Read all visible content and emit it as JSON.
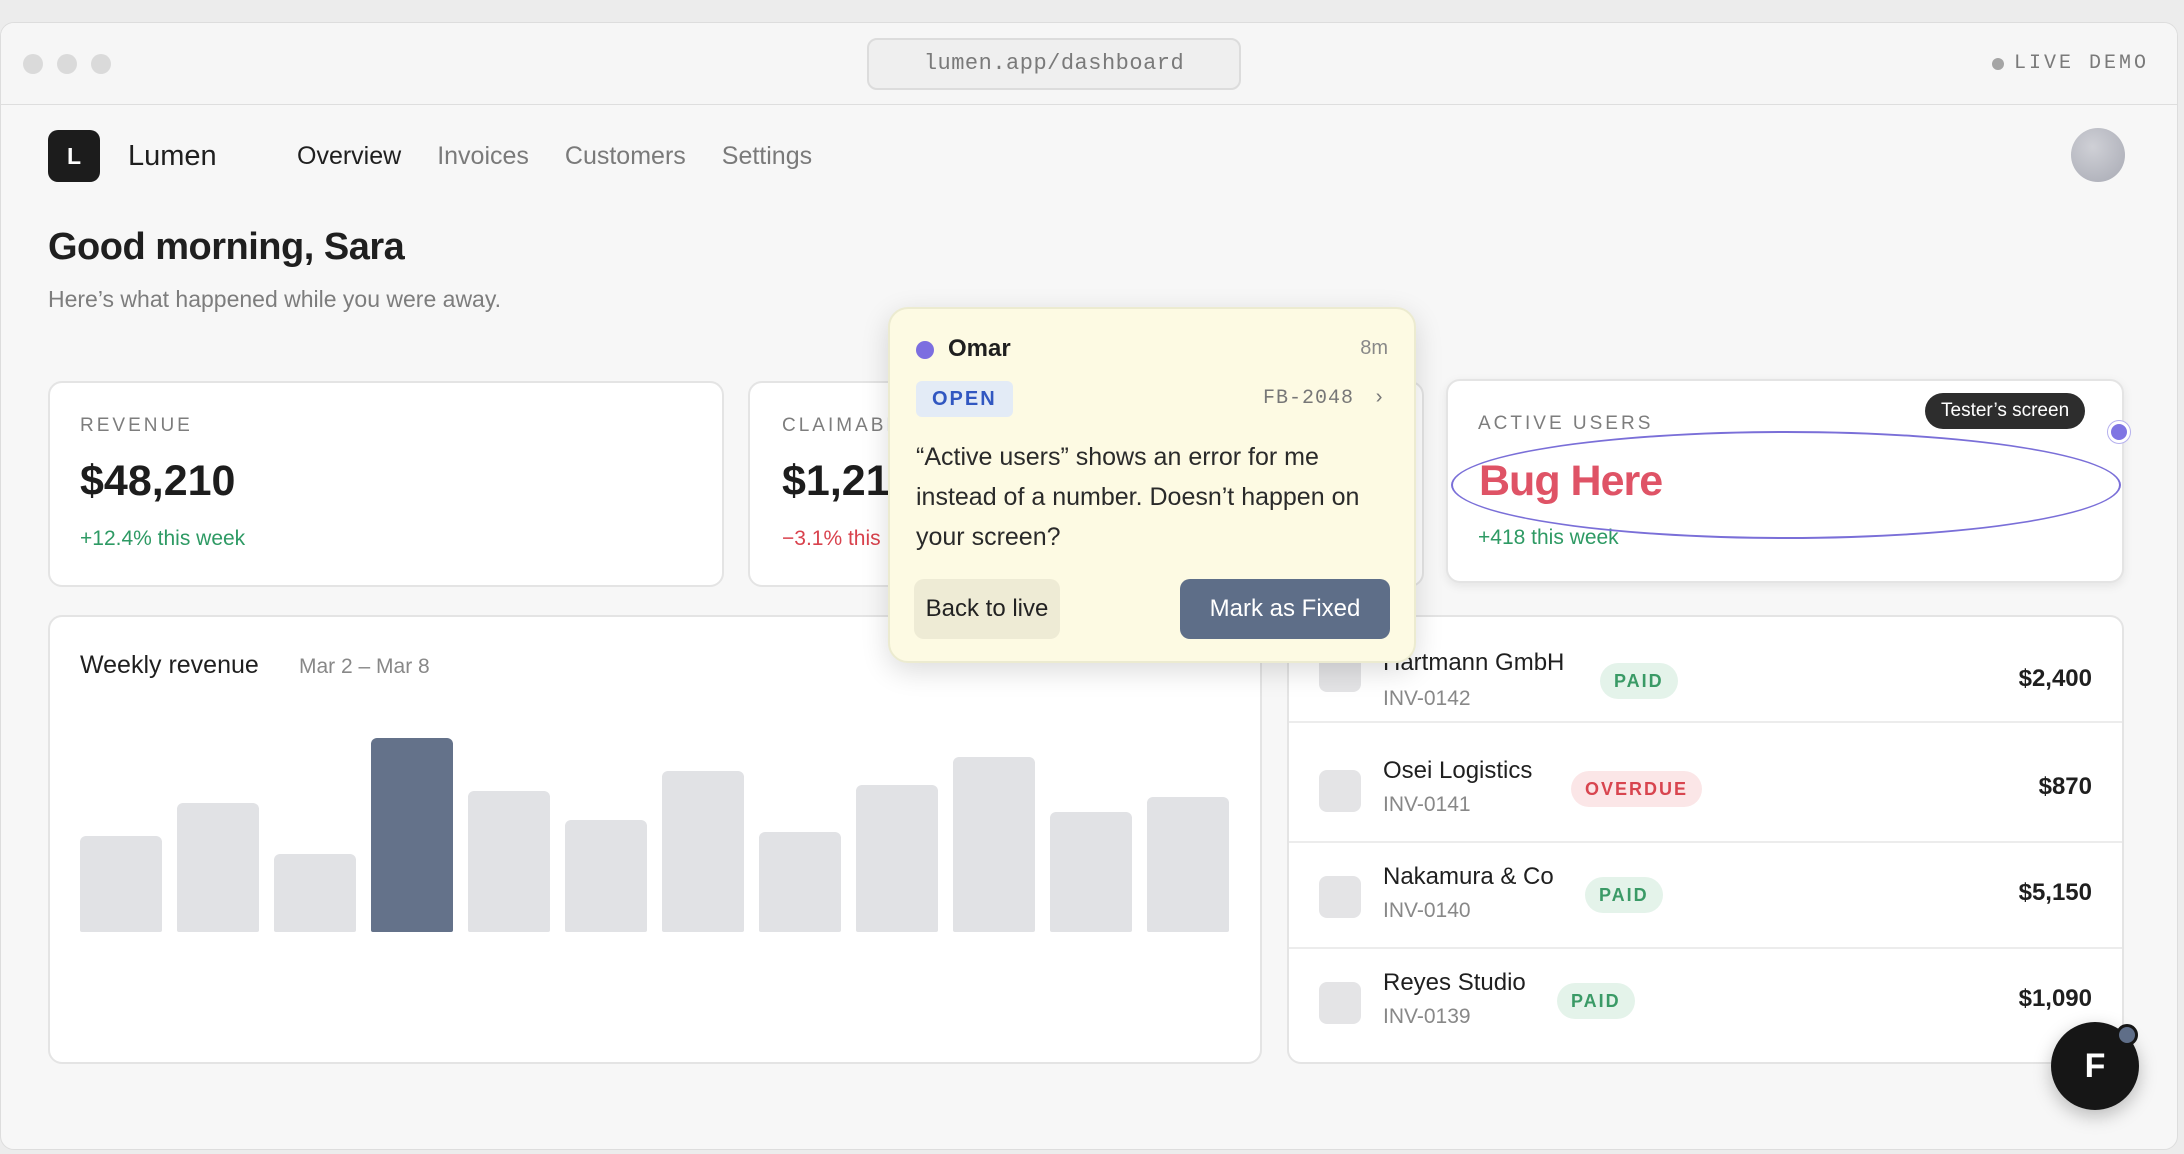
{
  "browser": {
    "url": "lumen.app/dashboard",
    "live_label": "LIVE DEMO"
  },
  "app": {
    "logo_letter": "L",
    "brand": "Lumen",
    "nav": [
      "Overview",
      "Invoices",
      "Customers",
      "Settings"
    ],
    "active_nav": "Overview"
  },
  "greeting": {
    "title": "Good morning, Sara",
    "subtitle": "Here’s what happened while you were away."
  },
  "stats": [
    {
      "label": "REVENUE",
      "value": "$48,210",
      "change": "+12.4% this week",
      "trend": "up"
    },
    {
      "label": "CLAIMABLE",
      "value": "$1,21",
      "change": "−3.1% this",
      "trend": "down"
    },
    {
      "label": "ACTIVE USERS",
      "value": "Bug Here",
      "change": "+418 this week",
      "trend": "up"
    }
  ],
  "chart": {
    "title": "Weekly revenue",
    "range": "Mar 2 – Mar 8"
  },
  "chart_data": {
    "type": "bar",
    "title": "Weekly revenue",
    "subtitle": "Mar 2 – Mar 8",
    "values": [
      47,
      63,
      38,
      95,
      69,
      55,
      79,
      49,
      72,
      86,
      59,
      66
    ],
    "highlight_index": 3,
    "colors": {
      "default": "#e1e2e5",
      "highlight": "#64728a"
    },
    "grid": false
  },
  "invoices": [
    {
      "name": "Hartmann GmbH",
      "id": "INV-0142",
      "status": "PAID",
      "amount": "$2,400"
    },
    {
      "name": "Osei Logistics",
      "id": "INV-0141",
      "status": "OVERDUE",
      "amount": "$870"
    },
    {
      "name": "Nakamura & Co",
      "id": "INV-0140",
      "status": "PAID",
      "amount": "$5,150"
    },
    {
      "name": "Reyes Studio",
      "id": "INV-0139",
      "status": "PAID",
      "amount": "$1,090"
    }
  ],
  "feedback": {
    "author": "Omar",
    "time": "8m",
    "status": "OPEN",
    "ticket": "FB-2048",
    "message": "“Active users” shows an error for me instead of a number. Doesn’t happen on your screen?",
    "back_label": "Back to live",
    "fix_label": "Mark as Fixed"
  },
  "tester_label": "Tester’s screen",
  "fab_letter": "F"
}
